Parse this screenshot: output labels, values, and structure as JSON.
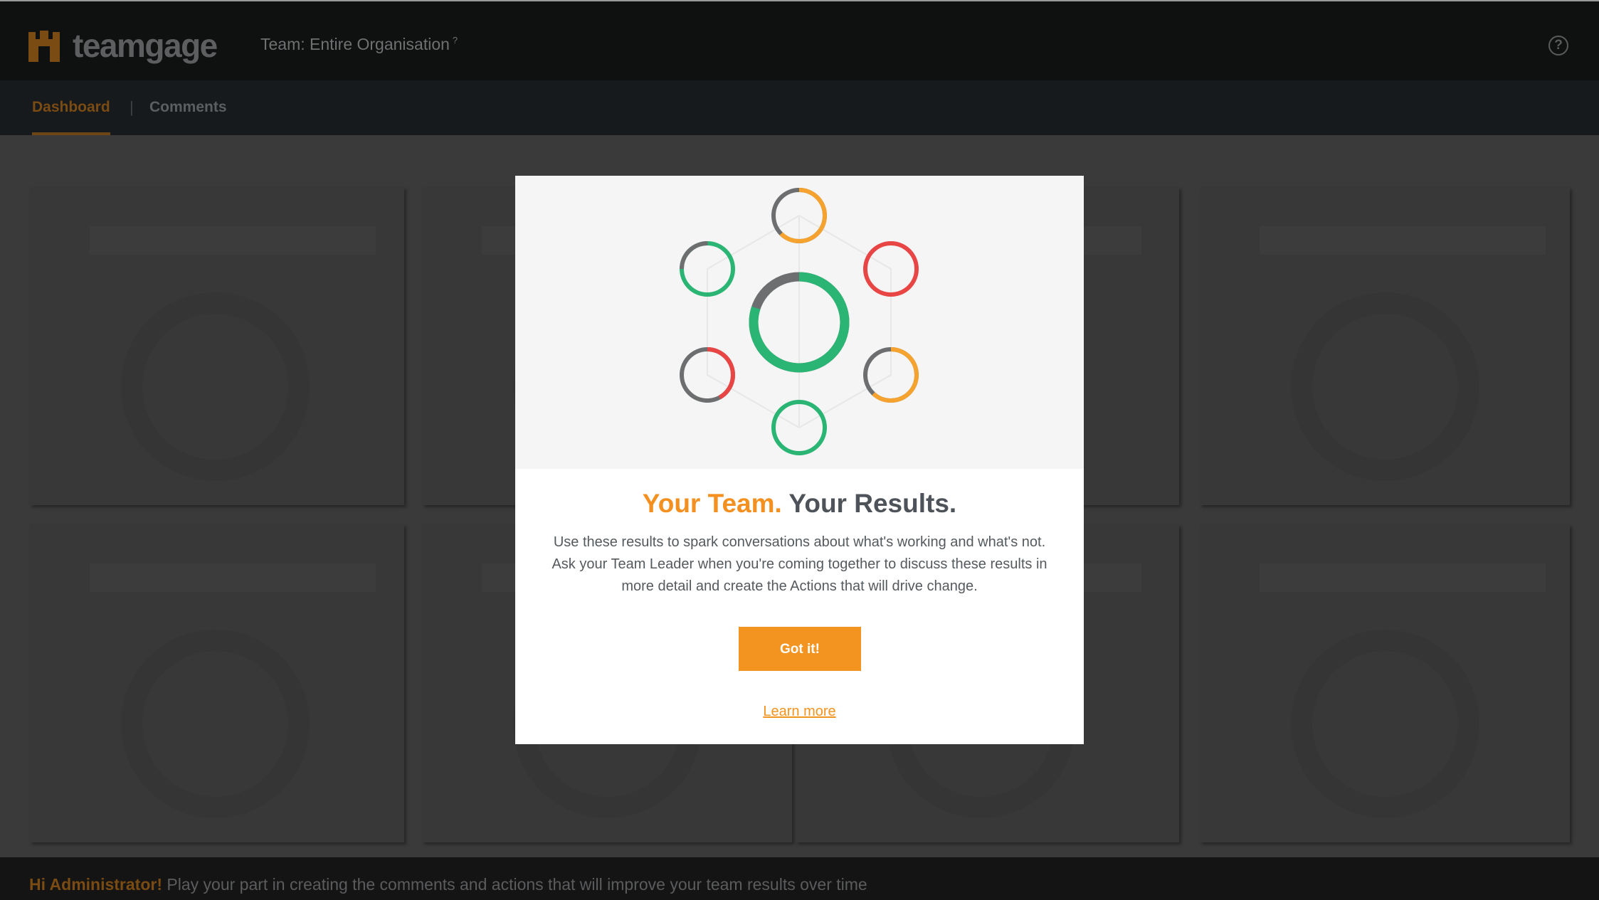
{
  "app": {
    "logo_text": "teamgage",
    "team_label": "Team: Entire Organisation",
    "team_info_glyph": "?",
    "help_glyph": "?",
    "help_icon": "question-circle-icon"
  },
  "nav": {
    "tabs": [
      {
        "label": "Dashboard",
        "active": true
      },
      {
        "label": "Comments",
        "active": false
      }
    ],
    "separator": "|"
  },
  "footer": {
    "greeting": "Hi Administrator!",
    "message": " Play your part in creating the comments and actions that will improve your team results over time"
  },
  "modal": {
    "title_accent": "Your Team.",
    "title_rest": " Your Results.",
    "body": "Use these results to spark conversations about what's working and what's not. Ask your Team Leader when you're coming together to discuss these results in more detail and create the Actions that will drive change.",
    "button_label": "Got it!",
    "link_label": "Learn more"
  },
  "colors": {
    "accent": "#f39420",
    "green": "#2bb574",
    "red": "#e84545",
    "orange": "#f6a22e",
    "grey": "#6d6e70"
  }
}
